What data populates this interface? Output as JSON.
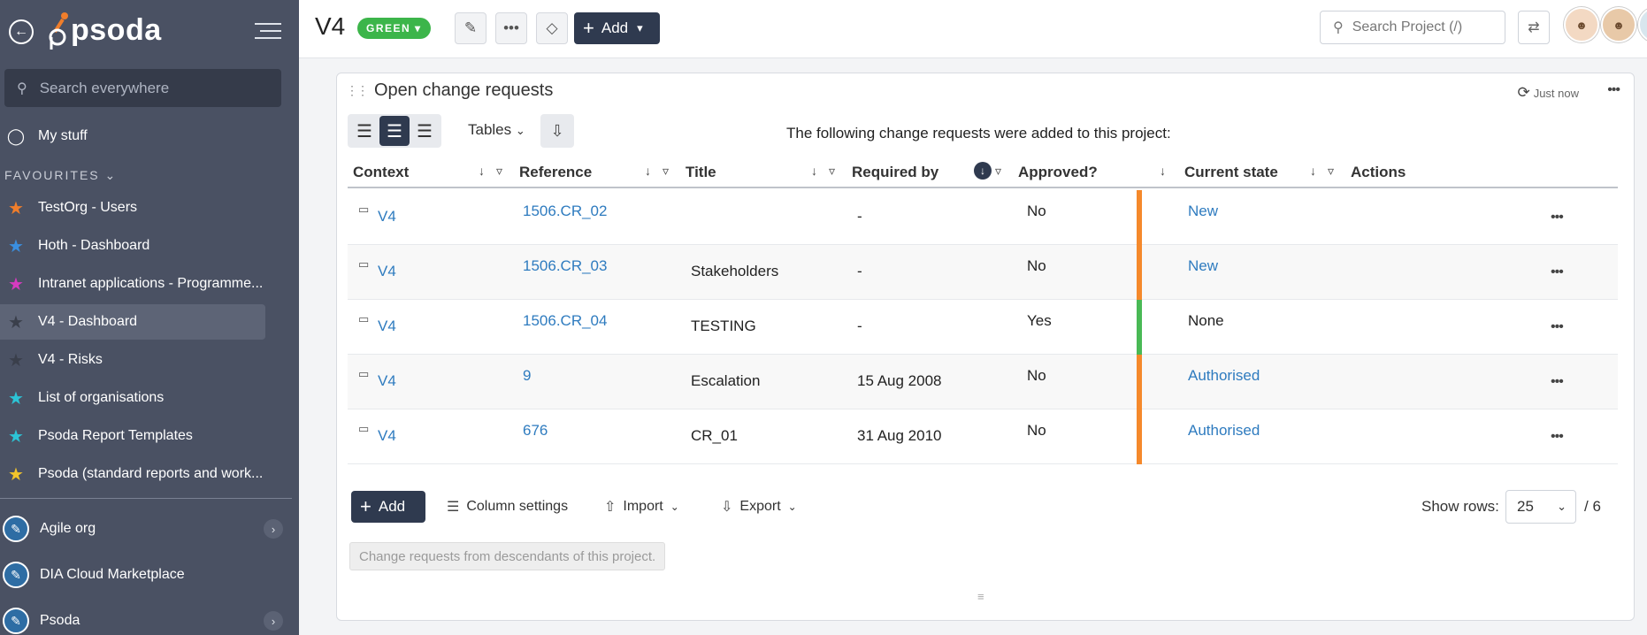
{
  "app": {
    "logo_text": "psoda"
  },
  "sidebar": {
    "search_placeholder": "Search everywhere",
    "my_stuff": "My stuff",
    "favourites_label": "FAVOURITES",
    "favourites": [
      {
        "label": "TestOrg - Users",
        "star_color": "#f07e2b"
      },
      {
        "label": "Hoth - Dashboard",
        "star_color": "#3a8fe0"
      },
      {
        "label": "Intranet applications - Programme...",
        "star_color": "#d63bc0"
      },
      {
        "label": "V4 - Dashboard",
        "star_color": "#3a3f4b"
      },
      {
        "label": "V4 - Risks",
        "star_color": "#3a3f4b"
      },
      {
        "label": "List of organisations",
        "star_color": "#2cc4d6"
      },
      {
        "label": "Psoda Report Templates",
        "star_color": "#2cc4d6"
      },
      {
        "label": "Psoda (standard reports and work...",
        "star_color": "#f3c52b"
      }
    ],
    "orgs": [
      {
        "label": "Agile org"
      },
      {
        "label": "DIA Cloud Marketplace"
      },
      {
        "label": "Psoda"
      }
    ]
  },
  "topbar": {
    "project": "V4",
    "status": "GREEN",
    "add_label": "Add",
    "search_placeholder": "Search Project (/)"
  },
  "panel": {
    "title": "Open change requests",
    "refreshed": "Just now",
    "tables_label": "Tables",
    "intro": "The following change requests were added to this project:",
    "columns": [
      "Context",
      "Reference",
      "Title",
      "Required by",
      "Approved?",
      "Current state",
      "Actions"
    ],
    "rows": [
      {
        "context": "V4",
        "reference": "1506.CR_02",
        "title": "",
        "required_by": "-",
        "approved": "No",
        "state": "New",
        "state_link": true,
        "bar_color": "#f5892b"
      },
      {
        "context": "V4",
        "reference": "1506.CR_03",
        "title": "Stakeholders",
        "required_by": "-",
        "approved": "No",
        "state": "New",
        "state_link": true,
        "bar_color": "#f5892b"
      },
      {
        "context": "V4",
        "reference": "1506.CR_04",
        "title": "TESTING",
        "required_by": "-",
        "approved": "Yes",
        "state": "None",
        "state_link": false,
        "bar_color": "#49b955"
      },
      {
        "context": "V4",
        "reference": "9",
        "title": "Escalation",
        "required_by": "15 Aug 2008",
        "approved": "No",
        "state": "Authorised",
        "state_link": true,
        "bar_color": "#f5892b"
      },
      {
        "context": "V4",
        "reference": "676",
        "title": "CR_01",
        "required_by": "31 Aug 2010",
        "approved": "No",
        "state": "Authorised",
        "state_link": true,
        "bar_color": "#f5892b"
      }
    ],
    "footer": {
      "add_label": "Add",
      "column_settings": "Column settings",
      "import": "Import",
      "export": "Export",
      "show_rows_label": "Show rows:",
      "rows_value": "25",
      "rows_total": "/ 6",
      "descendants_button": "Change requests from descendants of this project."
    }
  }
}
